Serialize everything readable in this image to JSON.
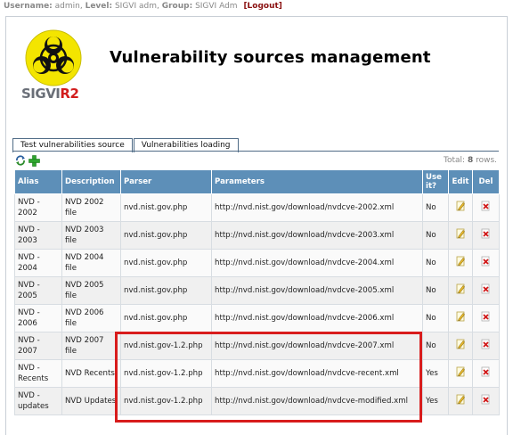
{
  "topbar": {
    "username_label": "Username:",
    "username": "admin,",
    "level_label": "Level:",
    "level": "SIGVI adm,",
    "group_label": "Group:",
    "group": "SIGVI Adm",
    "logout": "[Logout]"
  },
  "logo": {
    "part1": "SIGVI",
    "part2": "R2"
  },
  "page_title": "Vulnerability sources management",
  "tabs": [
    {
      "label": "Test vulnerabilities source"
    },
    {
      "label": "Vulnerabilities loading"
    }
  ],
  "toolbar": {
    "icons": [
      "refresh-icon",
      "add-icon"
    ],
    "total_label": "Total:",
    "total_count": "8",
    "total_suffix": "rows."
  },
  "table": {
    "headers": [
      "Alias",
      "Description",
      "Parser",
      "Parameters",
      "Use it?",
      "Edit",
      "Del"
    ],
    "rows": [
      {
        "alias": "NVD - 2002",
        "description": "NVD 2002 file",
        "parser": "nvd.nist.gov.php",
        "parameters": "http://nvd.nist.gov/download/nvdcve-2002.xml",
        "use": "No"
      },
      {
        "alias": "NVD - 2003",
        "description": "NVD 2003 file",
        "parser": "nvd.nist.gov.php",
        "parameters": "http://nvd.nist.gov/download/nvdcve-2003.xml",
        "use": "No"
      },
      {
        "alias": "NVD - 2004",
        "description": "NVD 2004 file",
        "parser": "nvd.nist.gov.php",
        "parameters": "http://nvd.nist.gov/download/nvdcve-2004.xml",
        "use": "No"
      },
      {
        "alias": "NVD - 2005",
        "description": "NVD 2005 file",
        "parser": "nvd.nist.gov.php",
        "parameters": "http://nvd.nist.gov/download/nvdcve-2005.xml",
        "use": "No"
      },
      {
        "alias": "NVD - 2006",
        "description": "NVD 2006 file",
        "parser": "nvd.nist.gov.php",
        "parameters": "http://nvd.nist.gov/download/nvdcve-2006.xml",
        "use": "No"
      },
      {
        "alias": "NVD - 2007",
        "description": "NVD 2007 file",
        "parser": "nvd.nist.gov-1.2.php",
        "parameters": "http://nvd.nist.gov/download/nvdcve-2007.xml",
        "use": "No"
      },
      {
        "alias": "NVD - Recents",
        "description": "NVD Recents",
        "parser": "nvd.nist.gov-1.2.php",
        "parameters": "http://nvd.nist.gov/download/nvdcve-recent.xml",
        "use": "Yes"
      },
      {
        "alias": "NVD - updates",
        "description": "NVD Updates",
        "parser": "nvd.nist.gov-1.2.php",
        "parameters": "http://nvd.nist.gov/download/nvdcve-modified.xml",
        "use": "Yes"
      }
    ]
  },
  "colors": {
    "header_bg": "#5d8fb8",
    "highlight": "#d81c1c",
    "logo_yellow": "#f3e500",
    "logo_red": "#d21d1d"
  }
}
